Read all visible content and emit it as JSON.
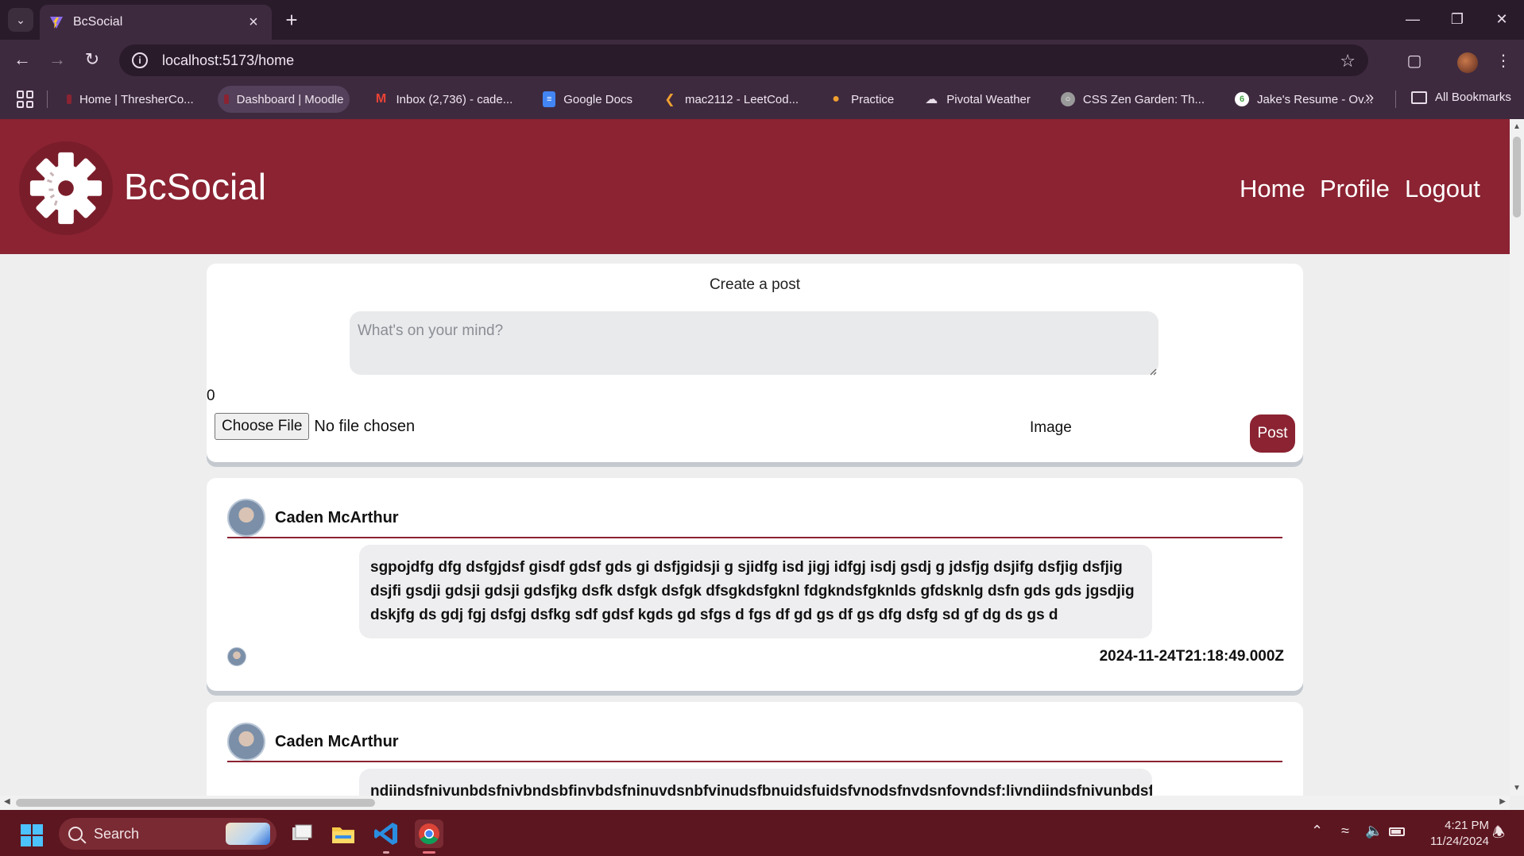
{
  "browser": {
    "tab_title": "BcSocial",
    "url": "localhost:5173/home",
    "bookmarks": [
      {
        "label": "Home | ThresherCo...",
        "color": "#8b2332"
      },
      {
        "label": "Dashboard | Moodle",
        "color": "#8b2332"
      },
      {
        "label": "Inbox (2,736) - cade...",
        "color": "#ea4335"
      },
      {
        "label": "Google Docs",
        "color": "#4285f4"
      },
      {
        "label": "mac2112 - LeetCod...",
        "color": "#f0a030"
      },
      {
        "label": "Practice",
        "color": "#f0a030"
      },
      {
        "label": "Pivotal Weather",
        "color": "#e8dde8"
      },
      {
        "label": "CSS Zen Garden: Th...",
        "color": "#9a9a9a"
      },
      {
        "label": "Jake's Resume - Ov...",
        "color": "#47a248"
      }
    ],
    "all_bookmarks": "All Bookmarks"
  },
  "app": {
    "brand": "BcSocial",
    "accent": "#8b2332",
    "nav": [
      "Home",
      "Profile",
      "Logout"
    ]
  },
  "create_post": {
    "title": "Create a post",
    "placeholder": "What's on your mind?",
    "char_count": "0",
    "choose_file": "Choose File",
    "no_file": "No file chosen",
    "image_label": "Image",
    "post_label": "Post"
  },
  "posts": [
    {
      "author": "Caden McArthur",
      "body": "sgpojdfg dfg dsfgjdsf gisdf gdsf gds gi dsfjgidsji g sjidfg isd jigj idfgj isdj gsdj g jdsfjg dsjifg dsfjig dsfjig dsjfi gsdji gdsji gdsji gdsfjkg dsfk dsfgk dsfgk dfsgkdsfgknl fdgkndsfgknlds gfdsknlg dsfn gds gds jgsdjig dskjfg ds gdj fgj dsfgj dsfkg sdf gdsf kgds gd sfgs d fgs df gd gs df gs dfg dsfg sd gf dg ds gs d",
      "timestamp": "2024-11-24T21:18:49.000Z"
    },
    {
      "author": "Caden McArthur",
      "body": "ndjjndsfnjvunbdsfnjvbndsbfjnvbdsfnjnuvdsnbfvjnudsfbnuidsfujdsfvnodsfnvdsnfovndsf;ljvndjjndsfnjvunbdsfnjvbndsbfjnvbdsfnjnuvdsnbfvjnudsfbnuidsfujdsfv"
    }
  ],
  "taskbar": {
    "search": "Search",
    "time": "4:21 PM",
    "date": "11/24/2024"
  }
}
